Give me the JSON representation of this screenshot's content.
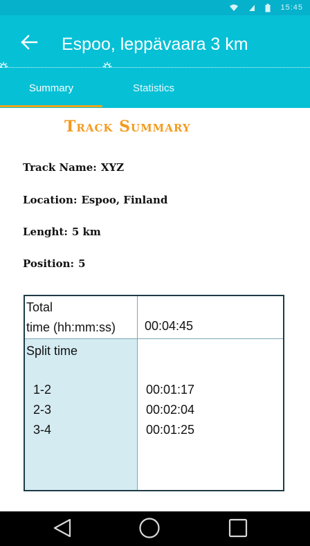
{
  "status_bar": {
    "time": "15:45"
  },
  "app_bar": {
    "title": "Espoo, leppävaara  3 km"
  },
  "tabs": [
    {
      "label": "Summary",
      "selected": true
    },
    {
      "label": "Statistics",
      "selected": false
    }
  ],
  "summary": {
    "heading": "Track Summary",
    "track_name": {
      "label": "Track  Name:",
      "value": "XYZ"
    },
    "location": {
      "label": "Location:",
      "value": "Espoo,  Finland"
    },
    "length": {
      "label": "Lenght:",
      "value": "5  km"
    },
    "position": {
      "label": "Position:",
      "value": "5"
    }
  },
  "time_table": {
    "total_label_line1": "Total",
    "total_label_line2": "time (hh:mm:ss)",
    "total_value": "00:04:45",
    "split_label": "Split time",
    "splits": [
      {
        "segment": "1-2",
        "time": "00:01:17"
      },
      {
        "segment": "2-3",
        "time": "00:02:04"
      },
      {
        "segment": "3-4",
        "time": "00:01:25"
      }
    ]
  },
  "colors": {
    "app_bar": "#06c0d6",
    "status_bar": "#06b1cc",
    "accent": "#f3a31a",
    "heading": "#f39a1c",
    "split_cell": "#d4ebf1"
  },
  "icons": {
    "back": "arrow-left-icon",
    "nav_back": "triangle-back-icon",
    "nav_home": "circle-home-icon",
    "nav_recents": "square-recents-icon"
  }
}
